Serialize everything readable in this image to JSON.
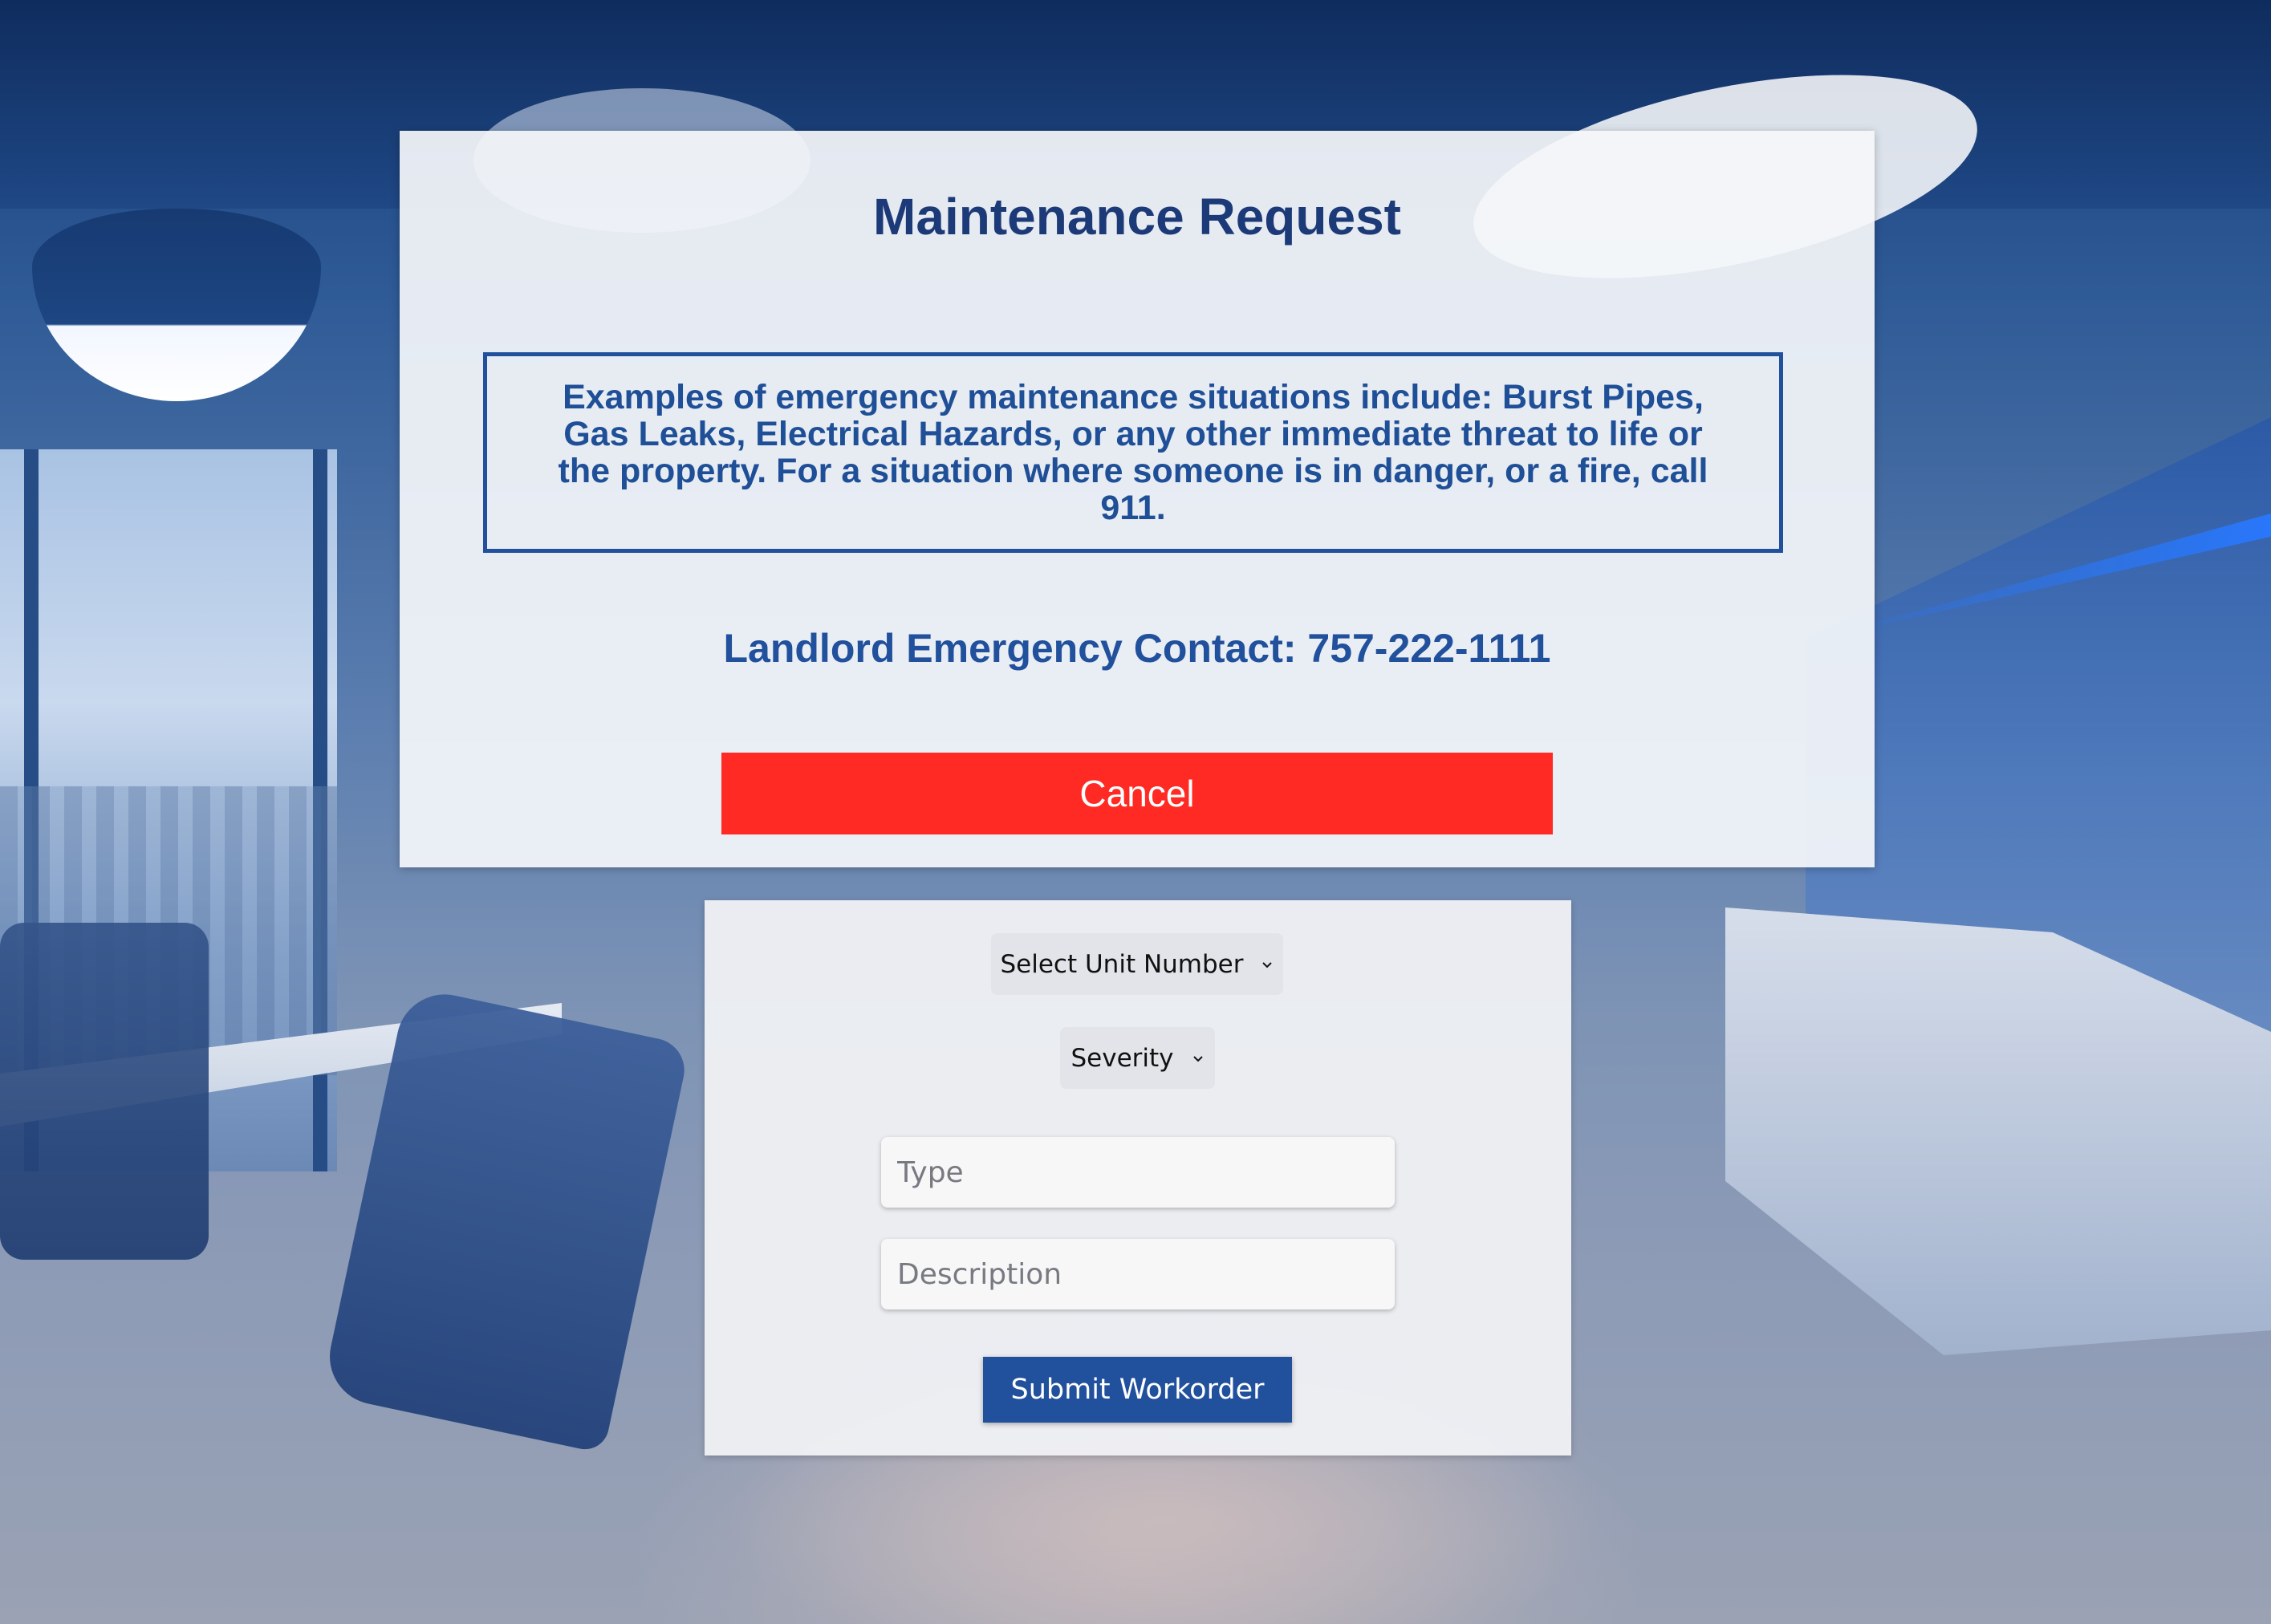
{
  "page": {
    "title": "Maintenance Request"
  },
  "notice": {
    "text": "Examples of emergency maintenance situations include: Burst Pipes, Gas Leaks, Electrical Hazards, or any other immediate threat to life or the property. For a situation where someone is in danger, or a fire, call 911."
  },
  "contact": {
    "text": "Landlord Emergency Contact: 757-222-1111"
  },
  "cancel": {
    "label": "Cancel"
  },
  "form": {
    "unit_select": {
      "selected": "Select Unit Number",
      "icon": "chevron-down-icon"
    },
    "severity_select": {
      "selected": "Severity",
      "icon": "chevron-down-icon"
    },
    "type_field": {
      "value": "",
      "placeholder": "Type"
    },
    "description_field": {
      "value": "",
      "placeholder": "Description"
    },
    "submit_label": "Submit Workorder"
  },
  "colors": {
    "title": "#1d3a78",
    "accent_blue": "#21509c",
    "cancel_red": "#ff2a23",
    "panel_bg": "#f4f6fa"
  }
}
